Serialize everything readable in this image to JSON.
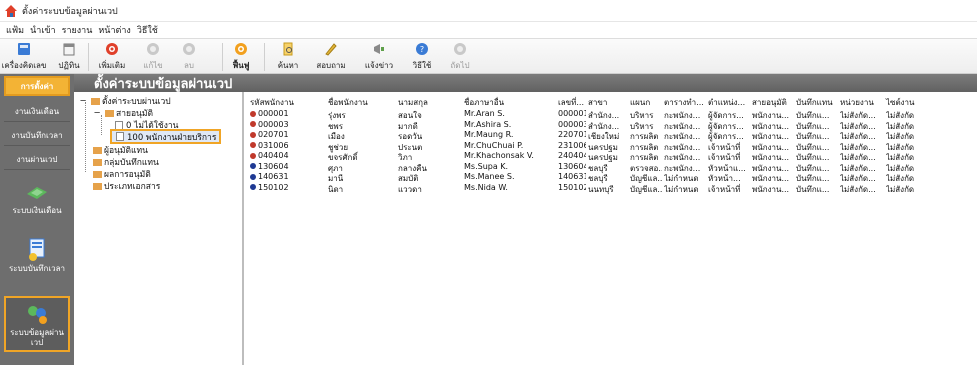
{
  "window": {
    "title": "ตั้งค่าระบบข้อมูลผ่านเวป"
  },
  "menu": [
    "แฟ้ม",
    "นำเข้า",
    "รายงาน",
    "หน้าต่าง",
    "วิธีใช้"
  ],
  "toolbar": {
    "buttons": [
      {
        "label": "เครื่องคิดเลข",
        "icon": "calculator-icon",
        "enabled": true
      },
      {
        "label": "ปฏิทิน",
        "icon": "calendar-icon",
        "enabled": true
      },
      {
        "label": "เพิ่มเติม",
        "icon": "add-icon",
        "enabled": true
      },
      {
        "label": "แก้ไข",
        "icon": "edit-icon",
        "enabled": false
      },
      {
        "label": "ลบ",
        "icon": "delete-icon",
        "enabled": false
      },
      {
        "label": "ฟื้นฟู",
        "icon": "refresh-icon",
        "enabled": true
      },
      {
        "label": "ค้นหา",
        "icon": "search-icon",
        "enabled": true
      },
      {
        "label": "สอบถาม",
        "icon": "query-icon",
        "enabled": true
      },
      {
        "label": "แจ้งข่าว",
        "icon": "announce-icon",
        "enabled": true
      },
      {
        "label": "วิธีใช้",
        "icon": "help-icon",
        "enabled": true
      },
      {
        "label": "ถัดไป",
        "icon": "next-icon",
        "enabled": false
      }
    ]
  },
  "sidebar": {
    "items": [
      {
        "label": "การตั้งค่า",
        "active": true
      },
      {
        "label": "งานเงินเดือน",
        "active": false
      },
      {
        "label": "งานบันทึกเวลา",
        "active": false
      },
      {
        "label": "งานผ่านเวป",
        "active": false
      }
    ],
    "modules": [
      {
        "label": "ระบบเงินเดือน",
        "icon": "salary-icon",
        "active": false
      },
      {
        "label": "ระบบบันทึกเวลา",
        "icon": "time-record-icon",
        "active": false
      },
      {
        "label": "ระบบข้อมูลผ่านเวป",
        "icon": "web-data-icon",
        "active": true
      }
    ]
  },
  "page": {
    "heading": "ตั้งค่าระบบข้อมูลผ่านเวป"
  },
  "tree": {
    "root": "ตั้งค่าระบบผ่านเวป",
    "nodes": [
      {
        "label": "สายอนุมัติ",
        "level": 1
      },
      {
        "label": "0 ไม่ได้ใช้งาน",
        "level": 2
      },
      {
        "label": "100 พนักงานฝ่ายบริการ",
        "level": 2,
        "selected": true
      },
      {
        "label": "ผู้อนุมัติแทน",
        "level": 1
      },
      {
        "label": "กลุ่มบันทึกแทน",
        "level": 1
      },
      {
        "label": "ผลการอนุมัติ",
        "level": 1
      },
      {
        "label": "ประเภทเอกสาร",
        "level": 1
      }
    ]
  },
  "grid": {
    "columns": [
      "รหัสพนักงาน",
      "ชื่อพนักงาน",
      "นามสกุล",
      "ชื่อภาษาอื่น",
      "เลขที่...",
      "สาขา",
      "แผนก",
      "ตารางทำ...",
      "ตำแหน่ง...",
      "สายอนุมัติ",
      "บันทึกแทน",
      "หน่วยงาน",
      "ไซต์งาน"
    ],
    "rows": [
      [
        "000001",
        "รุ่งพร",
        "สอนใจ",
        "Mr.Aran S.",
        "000001",
        "สำนักง...",
        "บริหาร",
        "กะพนักง...",
        "ผู้จัดการ...",
        "พนักงาน...",
        "บันทึกแ...",
        "ไม่สังกัด...",
        "ไม่สังกัด"
      ],
      [
        "000003",
        "ชพร",
        "มากดี",
        "Mr.Ashira S.",
        "000003",
        "สำนักง...",
        "บริหาร",
        "กะพนักง...",
        "ผู้จัดการ...",
        "พนักงาน...",
        "บันทึกแ...",
        "ไม่สังกัด...",
        "ไม่สังกัด"
      ],
      [
        "020701",
        "เมือง",
        "รอดวัน",
        "Mr.Maung R.",
        "220701",
        "เชียงใหม่",
        "การผลิต",
        "กะพนักง...",
        "ผู้จัดการ...",
        "พนักงาน...",
        "บันทึกแ...",
        "ไม่สังกัด...",
        "ไม่สังกัด"
      ],
      [
        "031006",
        "ชูช่วย",
        "ประนต",
        "Mr.ChuChuai P.",
        "231006",
        "นครปฐม",
        "การผลิต",
        "กะพนักง...",
        "เจ้าหน้าที่",
        "พนักงาน...",
        "บันทึกแ...",
        "ไม่สังกัด...",
        "ไม่สังกัด"
      ],
      [
        "040404",
        "ขจรศักดิ์",
        "วิภา",
        "Mr.Khachonsak V.",
        "240404",
        "นครปฐม",
        "การผลิต",
        "กะพนักง...",
        "เจ้าหน้าที่",
        "พนักงาน...",
        "บันทึกแ...",
        "ไม่สังกัด...",
        "ไม่สังกัด"
      ],
      [
        "130604",
        "ศุภา",
        "กลางคืน",
        "Ms.Supa K.",
        "130604",
        "ชลบุรี",
        "ตรวจสอ...",
        "กะพนักง...",
        "หัวหน้าแ...",
        "พนักงาน...",
        "บันทึกแ...",
        "ไม่สังกัด...",
        "ไม่สังกัด"
      ],
      [
        "140631",
        "มานี",
        "สมบัติ",
        "Ms.Manee S.",
        "140631",
        "ชลบุรี",
        "บัญชีแล...",
        "ไม่กำหนด",
        "หัวหน้า...",
        "พนักงาน...",
        "บันทึกแ...",
        "ไม่สังกัด...",
        "ไม่สังกัด"
      ],
      [
        "150102",
        "นิดา",
        "แววดา",
        "Ms.Nida W.",
        "150102",
        "นนทบุรี",
        "บัญชีแล...",
        "ไม่กำหนด",
        "เจ้าหน้าที่",
        "พนักงาน...",
        "บันทึกแ...",
        "ไม่สังกัด...",
        "ไม่สังกัด"
      ]
    ],
    "row_icon_colors": [
      "#c0392b",
      "#c0392b",
      "#c0392b",
      "#c0392b",
      "#c0392b",
      "#1f3a93",
      "#1f3a93",
      "#1f3a93"
    ]
  },
  "colors": {
    "accent": "#f0a526",
    "sidebar_bg": "#6e6e6e",
    "header_bg": "#6b6b6b",
    "selection": "#dfe8f6"
  }
}
